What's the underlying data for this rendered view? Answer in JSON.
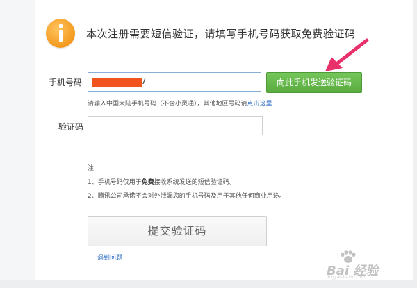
{
  "header": {
    "icon": "info-icon",
    "message": "本次注册需要短信验证，请填写手机号码获取免费验证码"
  },
  "phone": {
    "label": "手机号码",
    "value_visible_tail": "7",
    "send_button": "向此手机发送验证码",
    "hint_prefix": "请输入中国大陆手机号码（不含小灵通），其他地区号码请",
    "hint_link": "点击这里"
  },
  "code": {
    "label": "验证码",
    "value": ""
  },
  "notes": {
    "title": "注:",
    "item1_prefix": "1、手机号码仅用于",
    "item1_bold": "免费",
    "item1_suffix": "接收系统发送的短信验证码。",
    "item2": "2、腾讯公司承诺不会对外泄漏您的手机号码及用于其他任何商业用途。"
  },
  "actions": {
    "submit_label": "提交验证码",
    "problem_link": "遇到问题"
  },
  "watermark": {
    "brand": "Bai 经验",
    "sub": "jingyan.baidu.com"
  },
  "colors": {
    "accent_green": "#5aab40",
    "info_orange": "#f39a1e",
    "link_blue": "#2a6bc4",
    "annotation_arrow": "#e8306a",
    "redaction": "#f2541d"
  }
}
